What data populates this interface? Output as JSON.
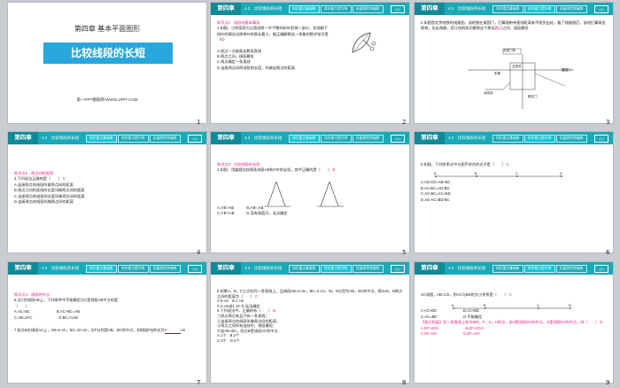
{
  "header": {
    "chapter": "第四章",
    "section": "4.2　比较线段的长短",
    "tabs": [
      "知识要点基础练",
      "综合能力提升练",
      "拓展探究突破练"
    ],
    "arrow": "◁ ▷"
  },
  "slide1": {
    "num": "1",
    "chapter_title": "第四章 基本平面图形",
    "title": "比较线段的长短",
    "site": "第一PPT模板网-WWW.1PPT.COM"
  },
  "slide2": {
    "num": "2",
    "kp": "知识点1　线段的基本事实",
    "q1": "1.如图，小明用剪刀沿直线将一片平整的树叶剪掉一部分，发现剩下树叶的周长比原树叶的周长要小，能正确解释这一现象的数学知识是（",
    "ans": "B",
    "q1_end": "）",
    "options": [
      "A.经过一点能画无数条直线",
      "B.两点之间，线段最短",
      "C.两点确定一条直线",
      "D.连接两点间的线段的长度，叫做这两点的距离"
    ]
  },
  "slide3": {
    "num": "3",
    "q": "2.如图是北京地铁的线路图，该地铁在建国门，打算随带带直线距离来不相交出站，看了线路图后，该地打算乘坐地铁，应走南路，用几何的知识解释这个原因",
    "ans": "两点",
    "ans_end": "之间，线段最短",
    "labels": [
      "天安门东",
      "建国门",
      "王府井",
      "东单",
      "崇文门",
      "北京站"
    ]
  },
  "slide4": {
    "num": "4",
    "kp": "知识点2　两点间的距离",
    "q": "3.下列说法正确的是（　　）",
    "ans": "C",
    "options": [
      "A.连接两点的线段叫做两点间的距离",
      "B.两点之间的直线的长度叫做两点间的距离",
      "C.连接两点的线段的长度叫做两点间的距离",
      "D.连接两点的线段叫做两点间的距离"
    ]
  },
  "slide5": {
    "num": "5",
    "kp": "知识点3　比较线段的长短",
    "q": "4.如图，用圆规比较两条线段AB和A'B'的长短，其中正确的是（　　）",
    "ans": "B",
    "options": [
      "A.A'B'>AB",
      "B.A'B'=AB",
      "C.A'B'<AB",
      "D.没有刻度尺，无法确定"
    ]
  },
  "slide6": {
    "num": "6",
    "q": "5.如图，下列关系式中与图不符合的式子是（　　）",
    "ans": "C",
    "options": [
      "A.AD-CD=AB+BC",
      "B.AC-BC=AD-BD",
      "C.AC-BC=AC+BD",
      "D.AD-AC=BD-BC"
    ],
    "points": [
      "A",
      "B",
      "C",
      "D"
    ]
  },
  "slide7": {
    "num": "7",
    "kp": "知识点4　线段的中点",
    "q": "6.点C在线段AB上，下列条件中不能确定点C是线段AB中点的是",
    "ans": "（　　）",
    "options": [
      "A.AC=BC",
      "B.AC+BC=AB",
      "C.AB=2AC",
      "D.BC=½AB"
    ],
    "q2": "7.若点B在线段AC上，AB=6 cm，BC=10 cm，点P分别是AB，BC的中点，则线段PQ的长为",
    "ans2": "8",
    "unit": "cm"
  },
  "slide8": {
    "num": "8",
    "q8": "8.如果A，B，C三点在同一条直线上，且线段AB=6 cm，BC=4 cm，M，N分别为AB，BC的中点，那么M，N两点之间的距离为（　　）",
    "ans8": "C",
    "options8": [
      "A.5 cm　B.1 cm",
      "C.5 cm或1 cm  D.无法确定"
    ],
    "q9": "9.下列说法中，正确的有（　　）",
    "ans9": "B",
    "stmts": [
      "①经过两点有且只有一条直线；",
      "②连接两点的线段叫做两点间的距离；",
      "③两点之间所有连线中，线段最短；",
      "④若AB=BC，则点B是线段AC的中点."
    ],
    "options9": [
      "A.1个　B.2个",
      "C.3个　D.4个"
    ]
  },
  "slide9": {
    "num": "9",
    "q": "10.如图，AB=CD，则AC与BD的大小关系是（　　）",
    "ans": "C",
    "options": [
      "A.AC>BD",
      "B.AC<BD",
      "C.AC=BD",
      "D.不能确定"
    ],
    "variant": "【变式拓展】在一条直线上依次有E，F，G，H四点，若H是线段EG的中点，G是线段FH的中点，则（　　）",
    "vans": "D",
    "voptions": [
      "A.EF>2GH",
      "B.EF<2GH",
      "C.EF=GH",
      "D.EF=GH"
    ],
    "points": [
      "A",
      "B",
      "C",
      "D"
    ]
  }
}
